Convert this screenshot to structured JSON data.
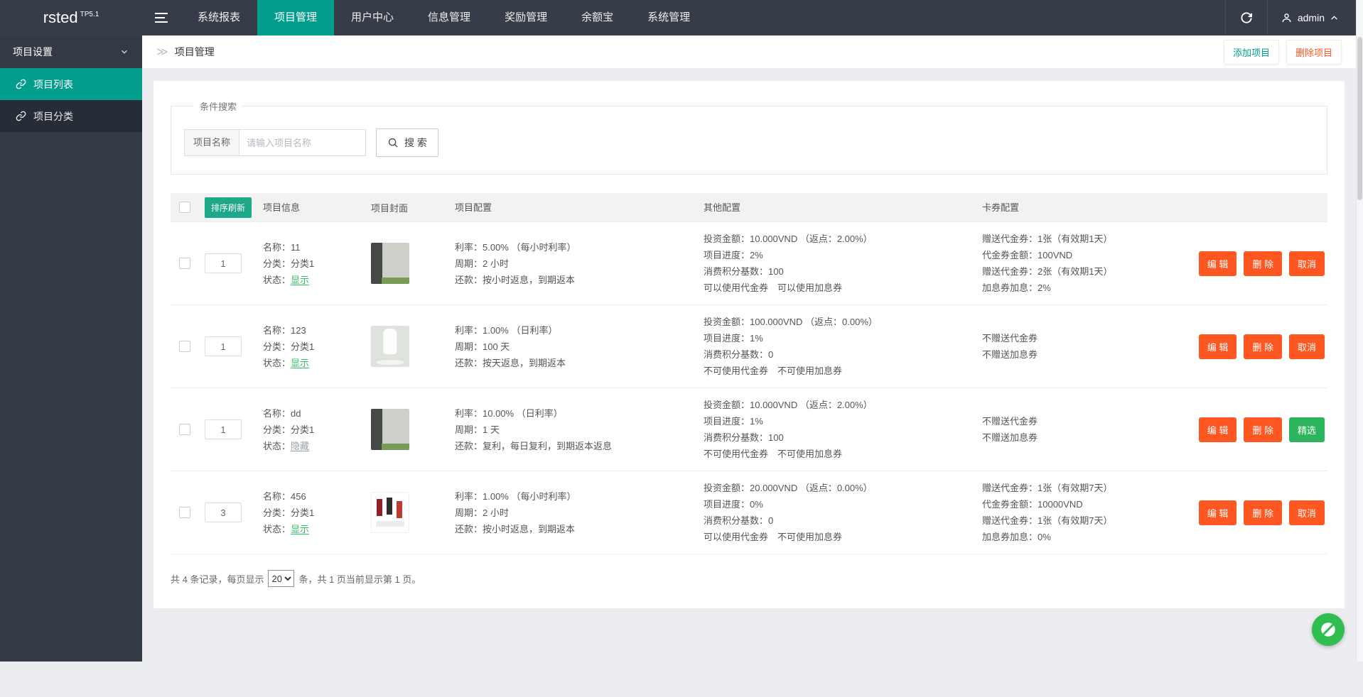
{
  "topbar": {
    "logo": "rsted",
    "logo_badge": "TP5.1",
    "nav": [
      {
        "label": "系统报表",
        "active": false
      },
      {
        "label": "项目管理",
        "active": true
      },
      {
        "label": "用户中心",
        "active": false
      },
      {
        "label": "信息管理",
        "active": false
      },
      {
        "label": "奖励管理",
        "active": false
      },
      {
        "label": "余额宝",
        "active": false
      },
      {
        "label": "系统管理",
        "active": false
      }
    ],
    "username": "admin"
  },
  "sidebar": {
    "group_label": "项目设置",
    "items": [
      {
        "label": "项目列表",
        "active": true
      },
      {
        "label": "项目分类",
        "active": false
      }
    ]
  },
  "breadcrumb": {
    "title": "项目管理"
  },
  "page_actions": {
    "add_label": "添加项目",
    "delete_label": "删除项目"
  },
  "search": {
    "legend": "条件搜索",
    "field_label": "项目名称",
    "placeholder": "请输入项目名称",
    "button_label": "搜 索"
  },
  "table": {
    "sort_button": "排序刷新",
    "headers": {
      "info": "项目信息",
      "cover": "项目封面",
      "config": "项目配置",
      "other": "其他配置",
      "coupon": "卡券配置"
    },
    "info_labels": {
      "name": "名称：",
      "category": "分类：",
      "status": "状态："
    },
    "rows": [
      {
        "sort": "1",
        "name": "11",
        "category": "分类1",
        "status": "显示",
        "status_type": "show",
        "cover": "building",
        "config": [
          "利率：5.00% （每小时利率）",
          "周期：2 小时",
          "还款：按小时返息，到期返本"
        ],
        "other": [
          "投资金额：10.000VND （返点：2.00%）",
          "项目进度：2%",
          "消费积分基数：100",
          "可以使用代金券　可以使用加息券"
        ],
        "coupon": [
          "赠送代金券：1张（有效期1天）",
          "代金券金额：100VND",
          "赠送代金券：2张（有效期1天）",
          "加息券加息：2%"
        ],
        "actions": [
          {
            "label": "编 辑",
            "style": "orange"
          },
          {
            "label": "删 除",
            "style": "orange"
          },
          {
            "label": "取消",
            "style": "orange"
          }
        ]
      },
      {
        "sort": "1",
        "name": "123",
        "category": "分类1",
        "status": "显示",
        "status_type": "show",
        "cover": "product-white",
        "config": [
          "利率：1.00% （日利率）",
          "周期：100 天",
          "还款：按天返息，到期返本"
        ],
        "other": [
          "投资金额：100.000VND （返点：0.00%）",
          "项目进度：1%",
          "消费积分基数：0",
          "不可使用代金券　不可使用加息券"
        ],
        "coupon": [
          "不赠送代金券",
          "不赠送加息券"
        ],
        "actions": [
          {
            "label": "编 辑",
            "style": "orange"
          },
          {
            "label": "删 除",
            "style": "orange"
          },
          {
            "label": "取消",
            "style": "orange"
          }
        ]
      },
      {
        "sort": "1",
        "name": "dd",
        "category": "分类1",
        "status": "隐藏",
        "status_type": "hide",
        "cover": "building",
        "config": [
          "利率：10.00% （日利率）",
          "周期：1 天",
          "还款：复利，每日复利，到期返本返息"
        ],
        "other": [
          "投资金额：10.000VND （返点：2.00%）",
          "项目进度：1%",
          "消费积分基数：100",
          "不可使用代金券　不可使用加息券"
        ],
        "coupon": [
          "不赠送代金券",
          "不赠送加息券"
        ],
        "actions": [
          {
            "label": "编 辑",
            "style": "orange"
          },
          {
            "label": "删 除",
            "style": "orange"
          },
          {
            "label": "精选",
            "style": "green"
          }
        ]
      },
      {
        "sort": "3",
        "name": "456",
        "category": "分类1",
        "status": "显示",
        "status_type": "show",
        "cover": "product-red",
        "config": [
          "利率：1.00% （每小时利率）",
          "周期：2 小时",
          "还款：按小时返息，到期返本"
        ],
        "other": [
          "投资金额：20.000VND （返点：0.00%）",
          "项目进度：0%",
          "消费积分基数：0",
          "可以使用代金券　不可使用加息券"
        ],
        "coupon": [
          "赠送代金券：1张（有效期7天）",
          "代金券金额：10000VND",
          "赠送代金券：1张（有效期7天）",
          "加息券加息：0%"
        ],
        "actions": [
          {
            "label": "编 辑",
            "style": "orange"
          },
          {
            "label": "删 除",
            "style": "orange"
          },
          {
            "label": "取消",
            "style": "orange"
          }
        ]
      }
    ]
  },
  "pagination": {
    "prefix": "共 4 条记录，每页显示",
    "page_size": "20",
    "suffix": "条，共 1 页当前显示第 1 页。"
  },
  "colors": {
    "topbar_bg": "#363c48",
    "sidebar_bg": "#333a46",
    "accent_teal": "#039d8c",
    "sort_button_green": "#1ea88a",
    "action_orange": "#ff5722",
    "status_green": "#2fbe63",
    "feature_green": "#2db55d",
    "fab_green": "#2fbe4f"
  }
}
